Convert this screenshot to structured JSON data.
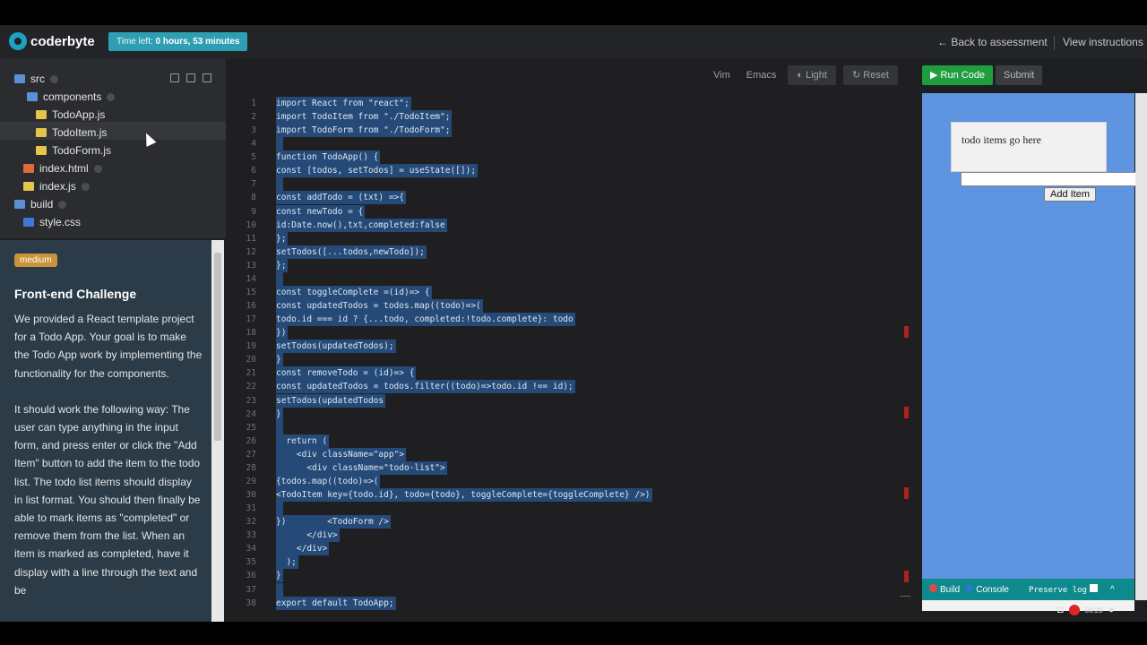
{
  "header": {
    "logo_text": "coderbyte",
    "timer_label": "Time left:",
    "timer_value": "0 hours, 53 minutes",
    "back_link": "← Back to assessment",
    "instructions_link": "View instructions"
  },
  "file_tree": {
    "items": [
      {
        "label": "src",
        "type": "folder"
      },
      {
        "label": "components",
        "type": "folder"
      },
      {
        "label": "TodoApp.js",
        "type": "js"
      },
      {
        "label": "TodoItem.js",
        "type": "js"
      },
      {
        "label": "TodoForm.js",
        "type": "js"
      },
      {
        "label": "index.html",
        "type": "html"
      },
      {
        "label": "index.js",
        "type": "js"
      },
      {
        "label": "build",
        "type": "folder"
      },
      {
        "label": "style.css",
        "type": "css"
      }
    ]
  },
  "description": {
    "badge": "medium",
    "title": "Front-end Challenge",
    "para1": "We provided a React template project for a Todo App. Your goal is to make the Todo App work by implementing the functionality for the components.",
    "para2": "It should work the following way: The user can type anything in the input form, and press enter or click the \"Add Item\" button to add the item to the todo list. The todo list items should display in list format. You should then finally be able to mark items as \"completed\" or remove them from the list. When an item is marked as completed, have it display with a line through the text and be"
  },
  "editor_toolbar": {
    "vim": "Vim",
    "emacs": "Emacs",
    "theme": "Light",
    "reset": "Reset"
  },
  "code": [
    "import React from \"react\";",
    "import TodoItem from \"./TodoItem\";",
    "import TodoForm from \"./TodoForm\";",
    "",
    "function TodoApp() {",
    "const [todos, setTodos] = useState([]);",
    "",
    "const addTodo = (txt) =>{",
    "const newTodo = {",
    "id:Date.now(),txt,completed:false",
    "};",
    "setTodos([...todos,newTodo]);",
    "};",
    "",
    "const toggleComplete =(id)=> {",
    "const updatedTodos = todos.map((todo)=>(",
    "todo.id === id ? {...todo, completed:!todo.complete}: todo",
    "})",
    "setTodos(updatedTodos);",
    "}",
    "const removeTodo = (id)=> {",
    "const updatedTodos = todos.filter((todo)=>todo.id !== id);",
    "setTodos(updatedTodos",
    "}",
    "",
    "  return (",
    "    <div className=\"app\">",
    "      <div className=\"todo-list\">",
    "{todos.map((todo)=>(",
    "<TodoItem key={todo.id}, todo={todo}, toggleComplete={toggleComplete} />)",
    "",
    "})        <TodoForm />",
    "      </div>",
    "    </div>",
    "  );",
    "}",
    "",
    "export default TodoApp;"
  ],
  "preview": {
    "run_label": "▶ Run Code",
    "submit_label": "Submit",
    "todo_heading": "todo items go here",
    "add_button": "Add Item",
    "build_tab": "Build",
    "console_tab": "Console",
    "preserve_log": "Preserve log",
    "record_time": "00:20"
  },
  "colors": {
    "accent_teal": "#2e9fb2",
    "run_green": "#1f9d3f",
    "preview_blue": "#5e94e0",
    "selection": "#254a78"
  }
}
